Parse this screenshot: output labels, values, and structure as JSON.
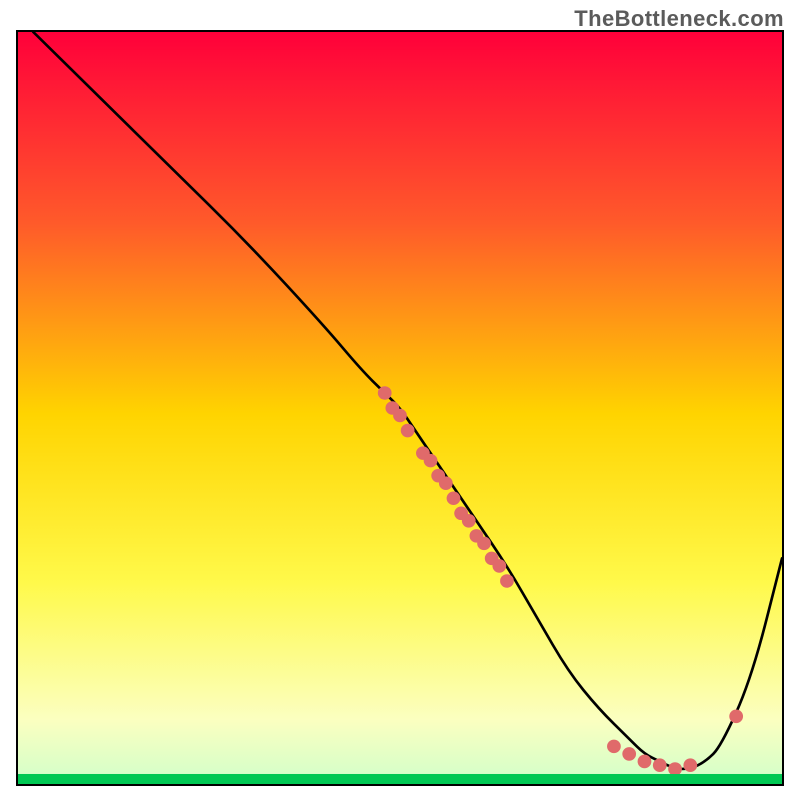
{
  "attribution": "TheBottleneck.com",
  "chart_data": {
    "type": "line",
    "title": "",
    "xlabel": "",
    "ylabel": "",
    "xlim": [
      0,
      100
    ],
    "ylim": [
      0,
      100
    ],
    "series": [
      {
        "name": "curve",
        "x": [
          2,
          10,
          20,
          30,
          40,
          45,
          48,
          50,
          52,
          54,
          56,
          58,
          60,
          64,
          68,
          72,
          76,
          80,
          82,
          84,
          86,
          88,
          90,
          92,
          96,
          100
        ],
        "y": [
          100,
          92,
          82,
          72,
          61,
          55,
          52,
          50,
          47,
          44,
          41,
          38,
          35,
          29,
          22,
          15,
          10,
          6,
          4,
          3,
          2,
          2,
          3,
          5,
          14,
          30
        ]
      }
    ],
    "markers": [
      {
        "x": 48,
        "y": 52
      },
      {
        "x": 49,
        "y": 50
      },
      {
        "x": 50,
        "y": 49
      },
      {
        "x": 51,
        "y": 47
      },
      {
        "x": 53,
        "y": 44
      },
      {
        "x": 54,
        "y": 43
      },
      {
        "x": 55,
        "y": 41
      },
      {
        "x": 56,
        "y": 40
      },
      {
        "x": 57,
        "y": 38
      },
      {
        "x": 58,
        "y": 36
      },
      {
        "x": 59,
        "y": 35
      },
      {
        "x": 60,
        "y": 33
      },
      {
        "x": 61,
        "y": 32
      },
      {
        "x": 62,
        "y": 30
      },
      {
        "x": 63,
        "y": 29
      },
      {
        "x": 64,
        "y": 27
      },
      {
        "x": 78,
        "y": 5
      },
      {
        "x": 80,
        "y": 4
      },
      {
        "x": 82,
        "y": 3
      },
      {
        "x": 84,
        "y": 2.5
      },
      {
        "x": 86,
        "y": 2
      },
      {
        "x": 88,
        "y": 2.5
      },
      {
        "x": 94,
        "y": 9
      }
    ],
    "background_gradient_stops": [
      {
        "offset": 0,
        "color": "#ff003a"
      },
      {
        "offset": 0.25,
        "color": "#ff5a2a"
      },
      {
        "offset": 0.5,
        "color": "#ffd400"
      },
      {
        "offset": 0.72,
        "color": "#fff94a"
      },
      {
        "offset": 0.9,
        "color": "#fbffc0"
      },
      {
        "offset": 0.97,
        "color": "#d8ffc8"
      },
      {
        "offset": 1.0,
        "color": "#00e060"
      }
    ],
    "marker_color": "#e06a6a"
  }
}
